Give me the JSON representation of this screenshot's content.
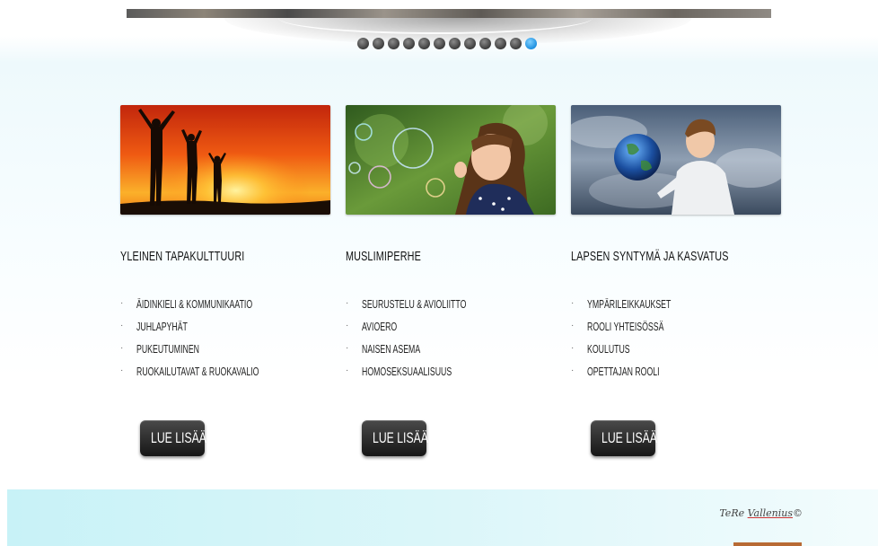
{
  "slider": {
    "dot_count": 12,
    "active_index": 11
  },
  "columns": [
    {
      "title": "YLEINEN TAPAKULTTUURI",
      "image": "sunset-silhouettes-image",
      "items": [
        "ÄIDINKIELI & KOMMUNIKAATIO",
        "JUHLAPYHÄT",
        "PUKEUTUMINEN",
        "RUOKAILUTAVAT & RUOKAVALIO"
      ],
      "button": "LUE LISÄÄ"
    },
    {
      "title": "MUSLIMIPERHE",
      "image": "girl-soap-bubbles-image",
      "items": [
        "SEURUSTELU & AVIOLIITTO",
        "AVIOERO",
        "NAISEN ASEMA",
        "HOMOSEKSUAALISUUS"
      ],
      "button": "LUE LISÄÄ"
    },
    {
      "title": "LAPSEN SYNTYMÄ JA KASVATUS",
      "image": "boy-holding-globe-image",
      "items": [
        "YMPÄRILEIKKAUKSET",
        "ROOLI YHTEISÖSSÄ",
        "KOULUTUS",
        "OPETTAJAN ROOLI"
      ],
      "button": "LUE LISÄÄ"
    }
  ],
  "footer": {
    "signature_first": "TeRe",
    "signature_last": "Vallenius",
    "copyright": "©"
  },
  "colors": {
    "active_dot": "#1e90e0",
    "footer_bg": "#c8f2f7",
    "footer_tab": "#b86a34"
  }
}
